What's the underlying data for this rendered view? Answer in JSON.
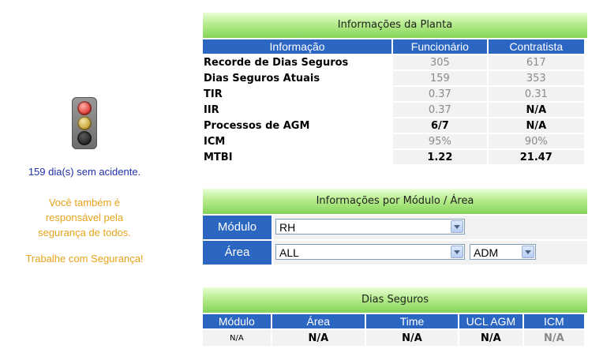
{
  "left": {
    "days_text": "159 dia(s) sem acidente.",
    "message_lines": [
      "Você também é",
      "responsável pela",
      "segurança de todos."
    ],
    "work_safe": "Trabalhe com Segurança!"
  },
  "plant_info": {
    "title": "Informações da Planta",
    "headers": [
      "Informação",
      "Funcionário",
      "Contratista"
    ],
    "rows": [
      {
        "label": "Recorde de Dias Seguros",
        "func": "305",
        "contr": "617"
      },
      {
        "label": "Dias Seguros Atuais",
        "func": "159",
        "contr": "353"
      },
      {
        "label": "TIR",
        "func": "0.37",
        "contr": "0.31"
      },
      {
        "label": "IIR",
        "func": "0.37",
        "contr": "N/A"
      },
      {
        "label": "Processos de AGM",
        "func": "6/7",
        "contr": "N/A"
      },
      {
        "label": "ICM",
        "func": "95%",
        "contr": "90%"
      },
      {
        "label": "MTBI",
        "func": "1.22",
        "contr": "21.47"
      }
    ]
  },
  "module_info": {
    "title": "Informações por Módulo / Área",
    "module_label": "Módulo",
    "module_value": "RH",
    "area_label": "Área",
    "area_value": "ALL",
    "sub_area_value": "ADM"
  },
  "safe_days": {
    "title": "Dias Seguros",
    "headers": [
      "Módulo",
      "Área",
      "Time",
      "UCL AGM",
      "ICM"
    ],
    "row": [
      "N/A",
      "N/A",
      "N/A",
      "N/A",
      "N/A"
    ]
  },
  "colors": {
    "header_blue": "#2b66c2",
    "header_green": "#86d45a",
    "days_text": "#1f2fa8",
    "message_orange": "#e8a21a"
  },
  "icons": {
    "traffic_light": "traffic-light-icon"
  }
}
